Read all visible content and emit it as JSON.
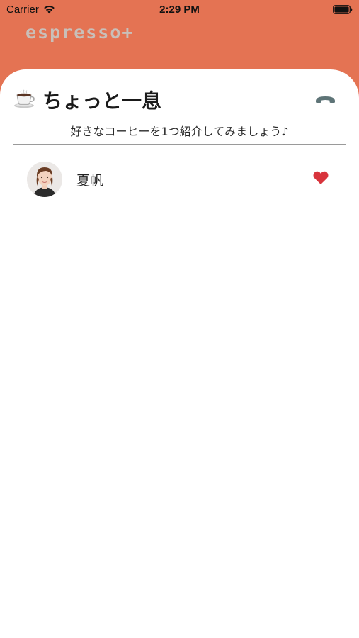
{
  "status_bar": {
    "carrier": "Carrier",
    "time": "2:29 PM",
    "wifi_icon": "wifi-icon",
    "battery_icon": "battery-icon"
  },
  "app": {
    "logo": "espresso+",
    "header_color": "#e47353",
    "logo_color": "#c9bfb9"
  },
  "room": {
    "icon": "coffee-icon",
    "title": "ちょっと一息",
    "subtitle": "好きなコーヒーを1つ紹介してみましょう♪",
    "hangup_icon": "phone-icon",
    "hangup_color": "#5e7477"
  },
  "members": [
    {
      "name": "夏帆",
      "avatar": "avatar",
      "liked": true,
      "heart_icon": "heart-icon",
      "heart_color": "#d8343c"
    }
  ]
}
